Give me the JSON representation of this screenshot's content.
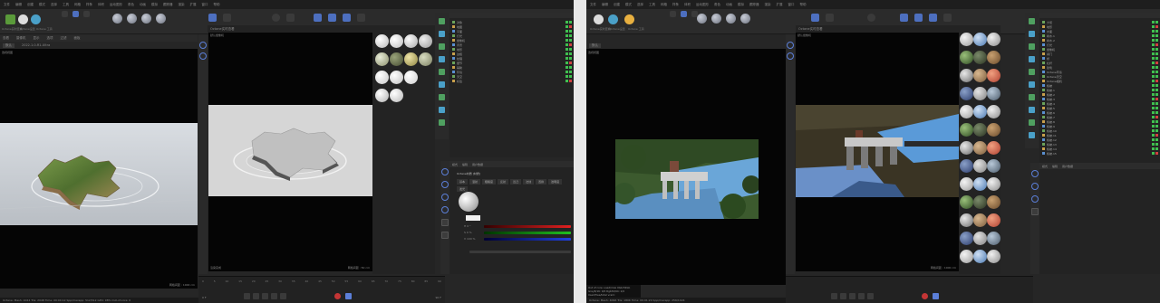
{
  "left": {
    "menu": [
      "文件",
      "编辑",
      "创建",
      "模式",
      "选择",
      "工具",
      "网格",
      "样条",
      "体积",
      "运动图形",
      "角色",
      "动画",
      "模拟",
      "跟踪器",
      "渲染",
      "扩展",
      "窗口",
      "帮助"
    ],
    "toolbar_labels": [
      "Octane实时查看",
      "Octane设置",
      "Octane 工具"
    ],
    "viewport_tabs": [
      "查看",
      "摄像机",
      "显示",
      "选项",
      "过滤",
      "面板"
    ],
    "viewport_caption": "2022.1.0-R1-Ultra",
    "render_title": "Octane实时查看",
    "perspective_label": "透视视图",
    "camera_label": "默认摄像机",
    "grid_label": "网格间距 : 1000 cm",
    "grid_label_right": "网格间距 : 50 cm",
    "render_status": "渲染完成",
    "timeline_frames": [
      "0",
      "5",
      "10",
      "15",
      "20",
      "25",
      "30",
      "35",
      "40",
      "45",
      "50",
      "55",
      "60",
      "65",
      "70",
      "75",
      "80",
      "85",
      "90"
    ],
    "frame_start": "0 F",
    "frame_end": "90 F",
    "objects": [
      "对象",
      "地图",
      "平面",
      "灯光",
      "摄像机",
      "背景",
      "地形",
      "边框",
      "纹理",
      "细节",
      "辅助",
      "环境",
      "天空",
      "标签"
    ],
    "attr_tabs": [
      "模式",
      "编辑",
      "用户数据"
    ],
    "attr_title": "Octane材质 [材质]",
    "attr_sub_tabs": [
      "基本",
      "漫射",
      "粗糙度",
      "反射",
      "凹凸",
      "法线",
      "置换",
      "透明度",
      "发光"
    ],
    "color_labels": [
      "H 0 °",
      "S 0 %",
      "V 100 %"
    ],
    "status_bar": "Octane:  Mesh: 1024  Tris: 2048  Time: 00:00:12  Spp/maxspp: 512/512  GPU: 98%  Out-of-core: 0"
  },
  "right": {
    "menu": [
      "文件",
      "编辑",
      "创建",
      "模式",
      "选择",
      "工具",
      "网格",
      "样条",
      "体积",
      "运动图形",
      "角色",
      "动画",
      "模拟",
      "跟踪器",
      "渲染",
      "扩展",
      "窗口",
      "帮助"
    ],
    "toolbar_labels": [
      "Octane实时查看",
      "Octane设置",
      "Octane 工具"
    ],
    "render_title": "Octane实时查看",
    "perspective_label": "透视视图",
    "camera_label": "默认摄像机",
    "grid_label": "网格间距 : 1000 cm",
    "objects": [
      "大坝",
      "地形",
      "水面",
      "树木.1",
      "树木.2",
      "灯光",
      "摄像机",
      "闸门",
      "桥",
      "栏杆",
      "建筑",
      "Octane环境",
      "Octane天空",
      "Octane相机",
      "植被",
      "植被.1",
      "植被.2",
      "植被.3",
      "植被.4",
      "植被.5",
      "植被.6",
      "植被.7",
      "植被.8",
      "植被.9",
      "植被.10",
      "植被.11",
      "植被.12",
      "植被.13",
      "植被.14",
      "植被.15"
    ],
    "console_lines": [
      "Out of core: used/max 0Gb/32Gb",
      "Grey8/16: 0/0    Rgb32/64: 1/0",
      "Used/free/total vram: 4.2Gb/7.8Gb/12Gb"
    ],
    "attr_tabs": [
      "模式",
      "编辑",
      "用户数据"
    ],
    "status_bar": "Octane:  Mesh: 4096  Tris: 180K  Time: 00:01:24  Spp/maxspp: 256/1024"
  }
}
